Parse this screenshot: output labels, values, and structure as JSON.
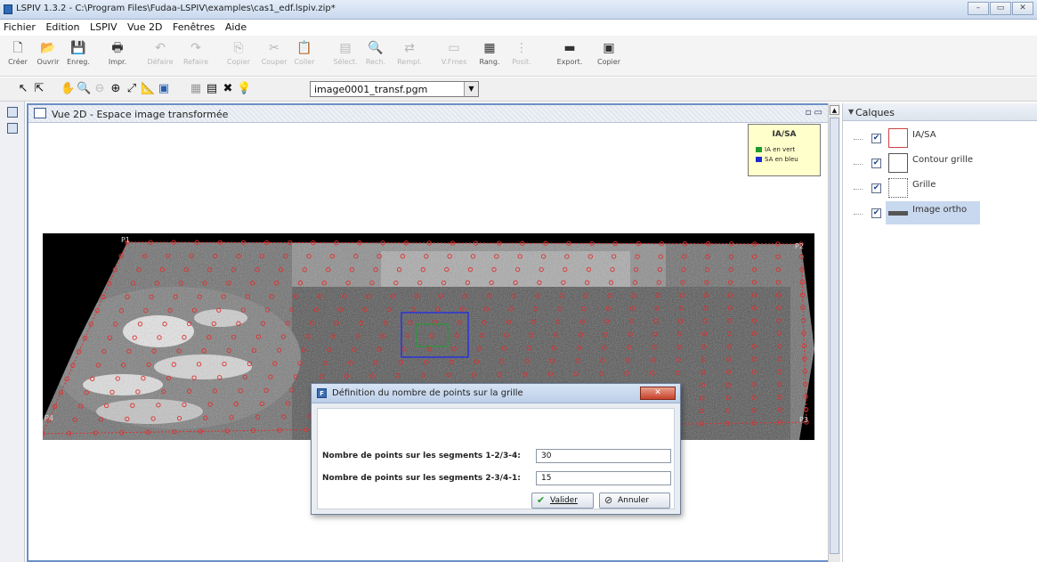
{
  "window": {
    "title": "LSPIV 1.3.2 - C:\\Program Files\\Fudaa-LSPIV\\examples\\cas1_edf.lspiv.zip*",
    "controls": [
      "–",
      "▭",
      "✕"
    ]
  },
  "menu": [
    "Fichier",
    "Edition",
    "LSPIV",
    "Vue 2D",
    "Fenêtres",
    "Aide"
  ],
  "toolbar1": [
    {
      "label": "Créer",
      "icon": "new-file-icon",
      "glyph": "🗋",
      "enabled": true
    },
    {
      "label": "Ouvrir",
      "icon": "open-folder-icon",
      "glyph": "📂",
      "enabled": true
    },
    {
      "label": "Enreg.",
      "icon": "save-icon",
      "glyph": "💾",
      "enabled": true
    },
    {
      "label": "Impr.",
      "icon": "print-icon",
      "glyph": "🖶",
      "enabled": true
    },
    {
      "label": "Défaire",
      "icon": "undo-icon",
      "glyph": "↶",
      "enabled": false
    },
    {
      "label": "Refaire",
      "icon": "redo-icon",
      "glyph": "↷",
      "enabled": false
    },
    {
      "label": "Copier",
      "icon": "copy-icon",
      "glyph": "⎘",
      "enabled": false
    },
    {
      "label": "Couper",
      "icon": "cut-icon",
      "glyph": "✂",
      "enabled": false
    },
    {
      "label": "Coller",
      "icon": "paste-icon",
      "glyph": "📋",
      "enabled": false
    },
    {
      "label": "Sélect.",
      "icon": "select-icon",
      "glyph": "▤",
      "enabled": false
    },
    {
      "label": "Rech.",
      "icon": "find-icon",
      "glyph": "🔍",
      "enabled": false
    },
    {
      "label": "Rempl.",
      "icon": "replace-icon",
      "glyph": "⇄",
      "enabled": false
    },
    {
      "label": "V.Fmes",
      "icon": "windows-icon",
      "glyph": "▭",
      "enabled": false
    },
    {
      "label": "Rang.",
      "icon": "arrange-icon",
      "glyph": "▦",
      "enabled": true
    },
    {
      "label": "Posit.",
      "icon": "position-icon",
      "glyph": "⋮",
      "enabled": false
    },
    {
      "label": "Export.",
      "icon": "export-icon",
      "glyph": "▬",
      "enabled": true
    },
    {
      "label": "Copier",
      "icon": "copy-image-icon",
      "glyph": "▣",
      "enabled": true
    }
  ],
  "toolbar2": {
    "icons": [
      "select-arrow-icon",
      "zoom-select-icon",
      "hand-icon",
      "zoom-in-icon",
      "zoom-out-icon",
      "zoom-box-icon",
      "pan-icon",
      "ruler-icon",
      "frame-icon",
      "grid-icon",
      "layers-icon",
      "tools-icon",
      "bulb-icon"
    ],
    "combo_value": "image0001_transf.pgm"
  },
  "view": {
    "title": "Vue 2D - Espace image transformée",
    "legend": {
      "title": "IA/SA",
      "items": [
        {
          "label": "IA en vert",
          "color": "#1a9a2a"
        },
        {
          "label": "SA en bleu",
          "color": "#1a2ad0"
        }
      ]
    },
    "point_labels": {
      "p1": "P1",
      "p2": "P2",
      "p3": "P3",
      "p4": "P4"
    }
  },
  "dialog": {
    "title": "Définition du nombre de points sur la grille",
    "close": "✕",
    "field1_label": "Nombre de points sur les segments 1-2/3-4:",
    "field1_value": "30",
    "field2_label": "Nombre de points sur les segments 2-3/4-1:",
    "field2_value": "15",
    "ok_label": "Valider",
    "cancel_label": "Annuler"
  },
  "calques": {
    "title": "Calques",
    "layers": [
      {
        "name": "IA/SA",
        "checked": true,
        "selected": false
      },
      {
        "name": "Contour grille",
        "checked": true,
        "selected": false
      },
      {
        "name": "Grille",
        "checked": true,
        "selected": false
      },
      {
        "name": "Image ortho",
        "checked": true,
        "selected": true
      }
    ]
  }
}
